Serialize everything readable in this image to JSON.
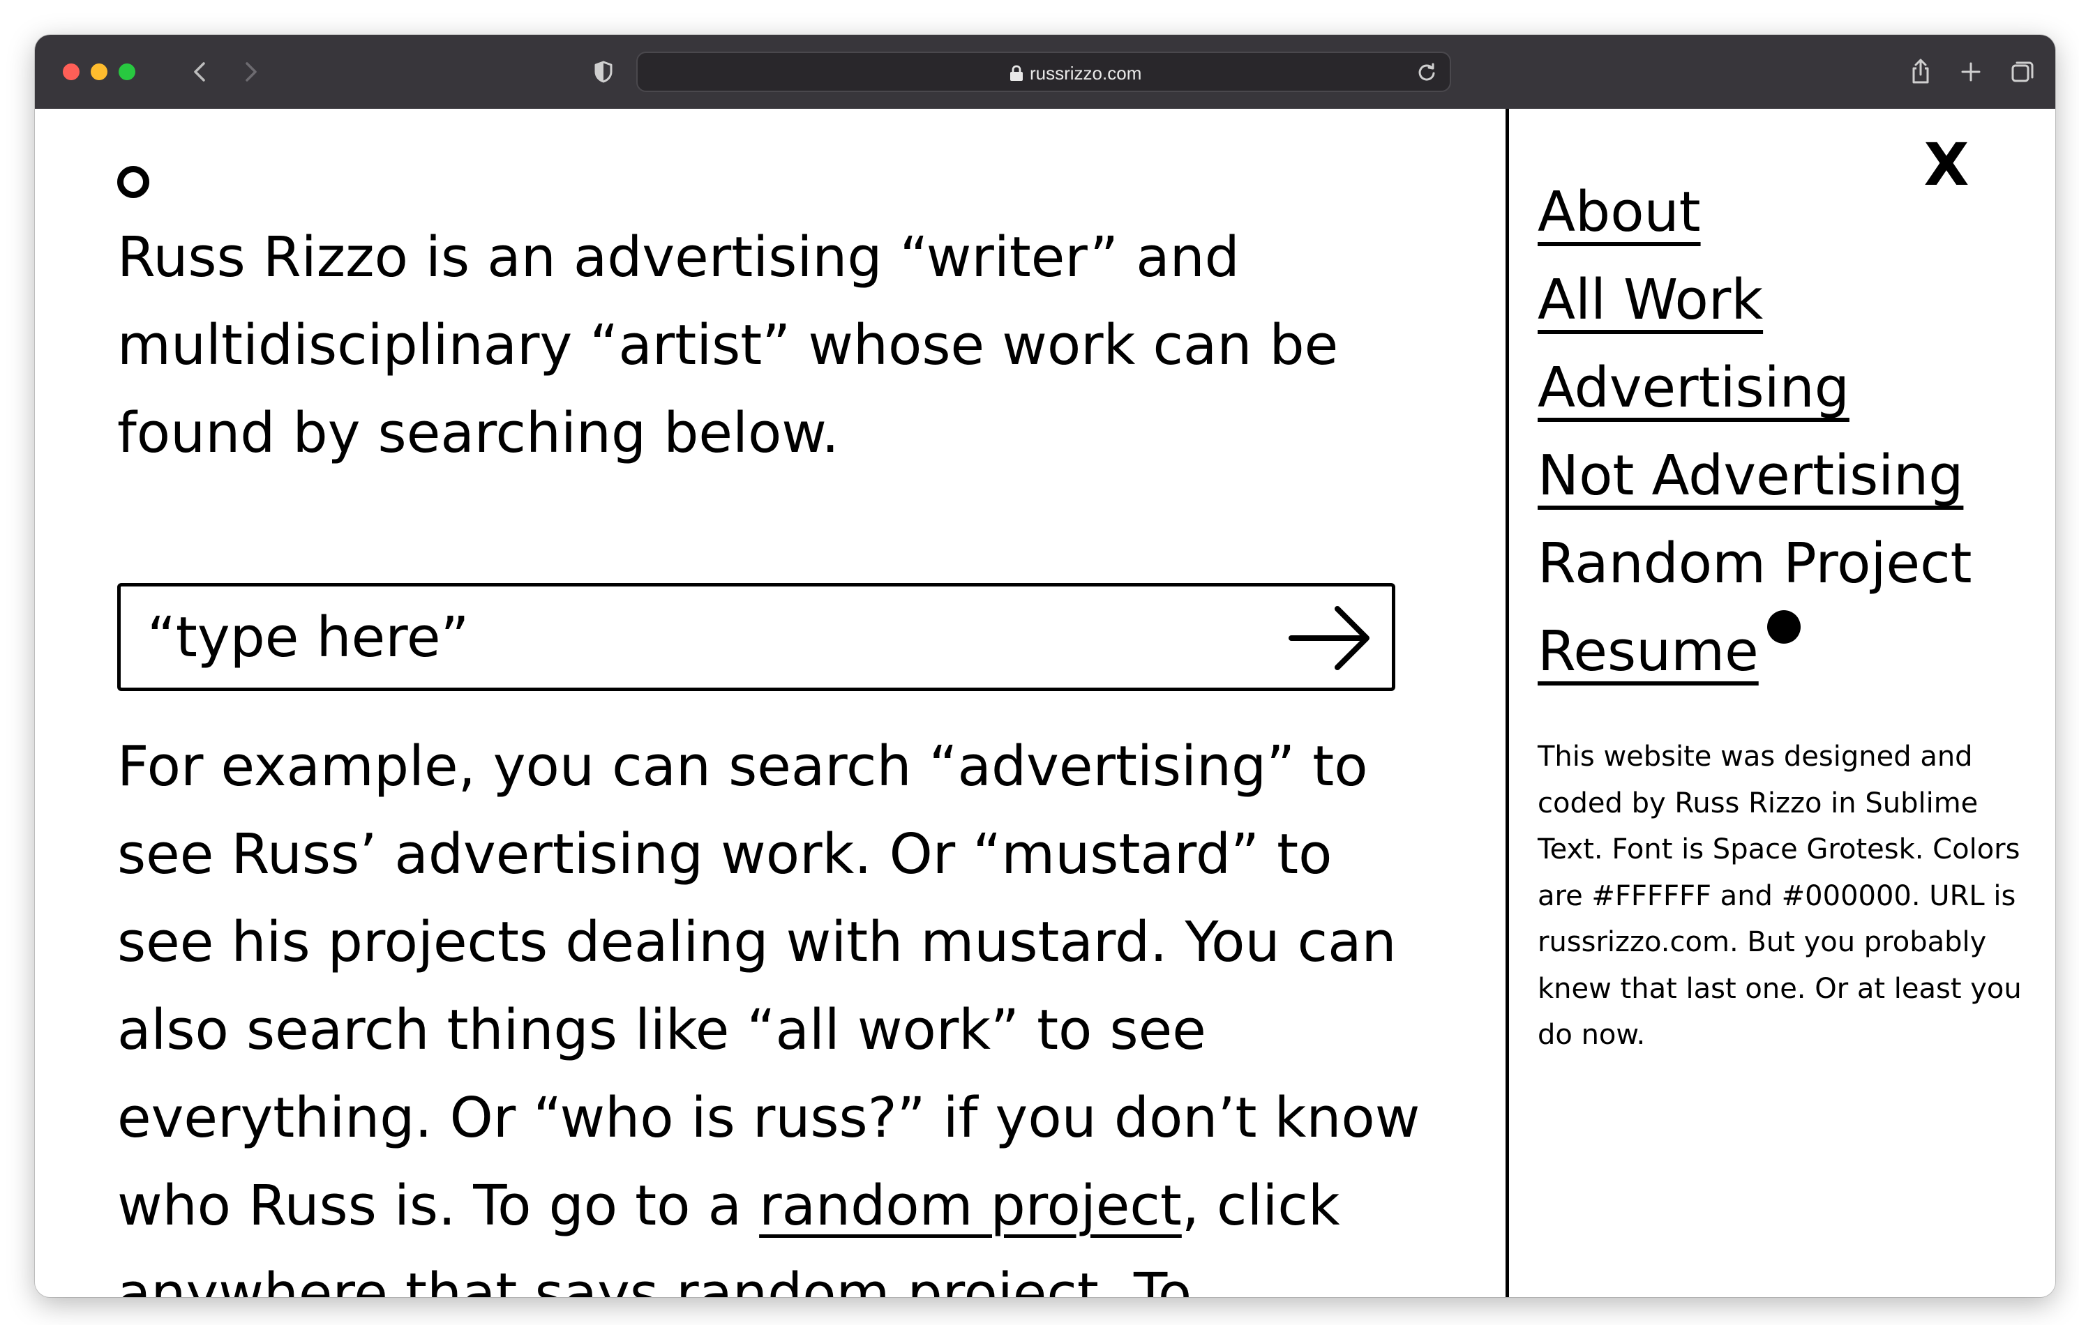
{
  "browser": {
    "url": "russrizzo.com",
    "buttons": {
      "back": "chevron-left-icon",
      "forward": "chevron-right-icon",
      "privacy": "shield-icon",
      "reload": "reload-icon",
      "share": "share-icon",
      "new_tab": "plus-icon",
      "tabs": "tabs-icon"
    }
  },
  "page": {
    "logo": "O",
    "intro": "Russ Rizzo is an advertising “writer” and multidisciplinary “artist” whose work can be found by searching below.",
    "search": {
      "placeholder": "“type here”",
      "value": ""
    },
    "body_before_link": "For example, you can search “advertising” to see Russ’ advertising work. Or “mustard” to see his projects dealing with mustard. You can also search things like “all work” to see everything. Or “who is russ?” if you don’t know who Russ is. To go to a ",
    "body_link": "random project",
    "body_after_link": ", click anywhere that says random project. To"
  },
  "menu": {
    "close_label": "X",
    "items": [
      {
        "label": "About"
      },
      {
        "label": "All Work"
      },
      {
        "label": "Advertising"
      },
      {
        "label": "Not Advertising"
      },
      {
        "label": "Random Project"
      },
      {
        "label": "Resume"
      }
    ],
    "credits": "This website was designed and coded by Russ Rizzo in Sublime Text. Font is Space Grotesk. Colors are #FFFFFF and #000000. URL is russrizzo.com. But you probably knew that last one. Or at least you do now."
  },
  "colors": {
    "background": "#FFFFFF",
    "foreground": "#000000",
    "toolbar": "#38363B"
  }
}
